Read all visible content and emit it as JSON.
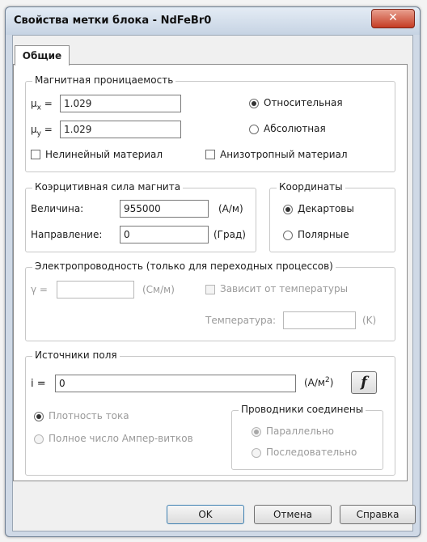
{
  "window": {
    "title": "Свойства метки блока - NdFeBr0",
    "close_label": "✕"
  },
  "tabs": [
    {
      "label": "Общие",
      "active": true
    }
  ],
  "permeability": {
    "title": "Магнитная проницаемость",
    "mu_x_label": "μx =",
    "mu_x_value": "1.029",
    "mu_y_label": "μy =",
    "mu_y_value": "1.029",
    "relative_label": "Относительная",
    "relative_checked": true,
    "absolute_label": "Абсолютная",
    "nonlinear_label": "Нелинейный материал",
    "anisotropic_label": "Анизотропный материал"
  },
  "coercive": {
    "title": "Коэрцитивная сила магнита",
    "magnitude_label": "Величина:",
    "magnitude_value": "955000",
    "magnitude_unit": "(А/м)",
    "direction_label": "Направление:",
    "direction_value": "0",
    "direction_unit": "(Град)"
  },
  "coordinates": {
    "title": "Координаты",
    "cartesian_label": "Декартовы",
    "cartesian_checked": true,
    "polar_label": "Полярные"
  },
  "conductivity": {
    "title": "Электропроводность (только для переходных процессов)",
    "gamma_label": "γ =",
    "gamma_value": "",
    "gamma_unit": "(См/м)",
    "temp_dependent_label": "Зависит от температуры",
    "temperature_label": "Температура:",
    "temperature_value": "",
    "temperature_unit": "(K)"
  },
  "sources": {
    "title": "Источники поля",
    "i_label": "i =",
    "i_value": "0",
    "i_unit": "(А/м",
    "i_unit_sup": "2",
    "i_unit_close": ")",
    "fx_label": "f",
    "current_density_label": "Плотность тока",
    "current_density_checked": true,
    "ampere_turns_label": "Полное число Ампер-витков"
  },
  "conductors": {
    "title": "Проводники соединены",
    "parallel_label": "Параллельно",
    "parallel_checked": true,
    "series_label": "Последовательно"
  },
  "buttons": {
    "ok": "OK",
    "cancel": "Отмена",
    "help": "Справка"
  }
}
